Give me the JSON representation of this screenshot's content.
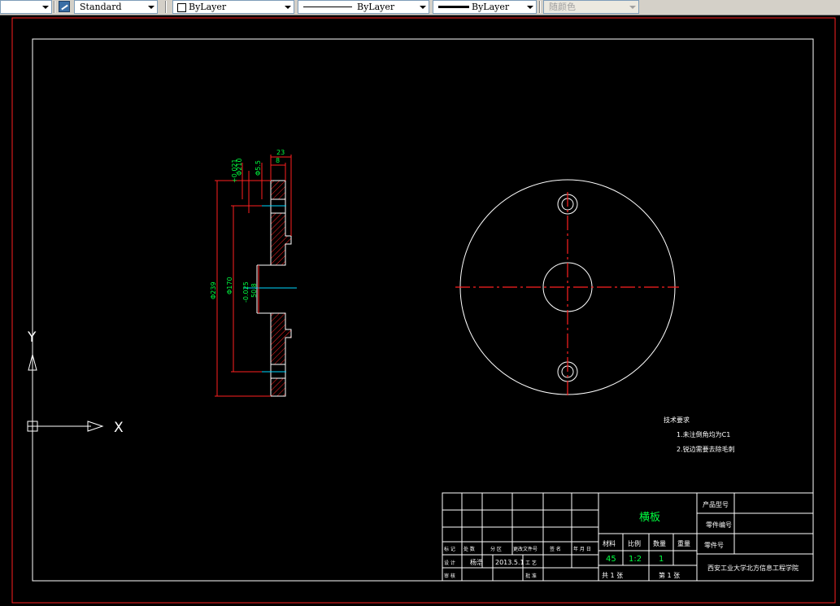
{
  "toolbar": {
    "text_style": "Standard",
    "layer": "ByLayer",
    "linetype": "ByLayer",
    "lineweight": "ByLayer",
    "color": "随颜色"
  },
  "ucs": {
    "x": "X",
    "y": "Y"
  },
  "section_dims": {
    "d1": "+0.021",
    "d2": "Φ210",
    "d3": "Φ5.5",
    "d4": "23",
    "d5": "8",
    "d6": "Φ239",
    "d7": "Φ170",
    "d8": "-0.025",
    "d9": "50.8"
  },
  "notes": {
    "title": "技术要求",
    "line1": "1.未注倒角均为C1",
    "line2": "2.锐边需要去除毛刺"
  },
  "title_block": {
    "part_name": "横板",
    "product_no_label": "产品型号",
    "part_no_label": "零件编号",
    "part_no2_label": "零件号",
    "material_label": "材料",
    "scale_label": "比例",
    "qty_label": "数量",
    "weight_label": "重量",
    "material": "45",
    "scale": "1:2",
    "qty": "1",
    "sheets_total": "共 1 张",
    "sheet_no": "第 1 张",
    "school": "西安工业大学北方信息工程学院",
    "rev_labels": [
      "标 记",
      "处 数",
      "分 区",
      "更改文件号",
      "签 名",
      "年 月 日"
    ],
    "design_label": "设 计",
    "designer": "杨浩",
    "date": "2013.5.1",
    "std_label": "工 艺",
    "check_label": "审 核",
    "approve_label": "批 准"
  }
}
